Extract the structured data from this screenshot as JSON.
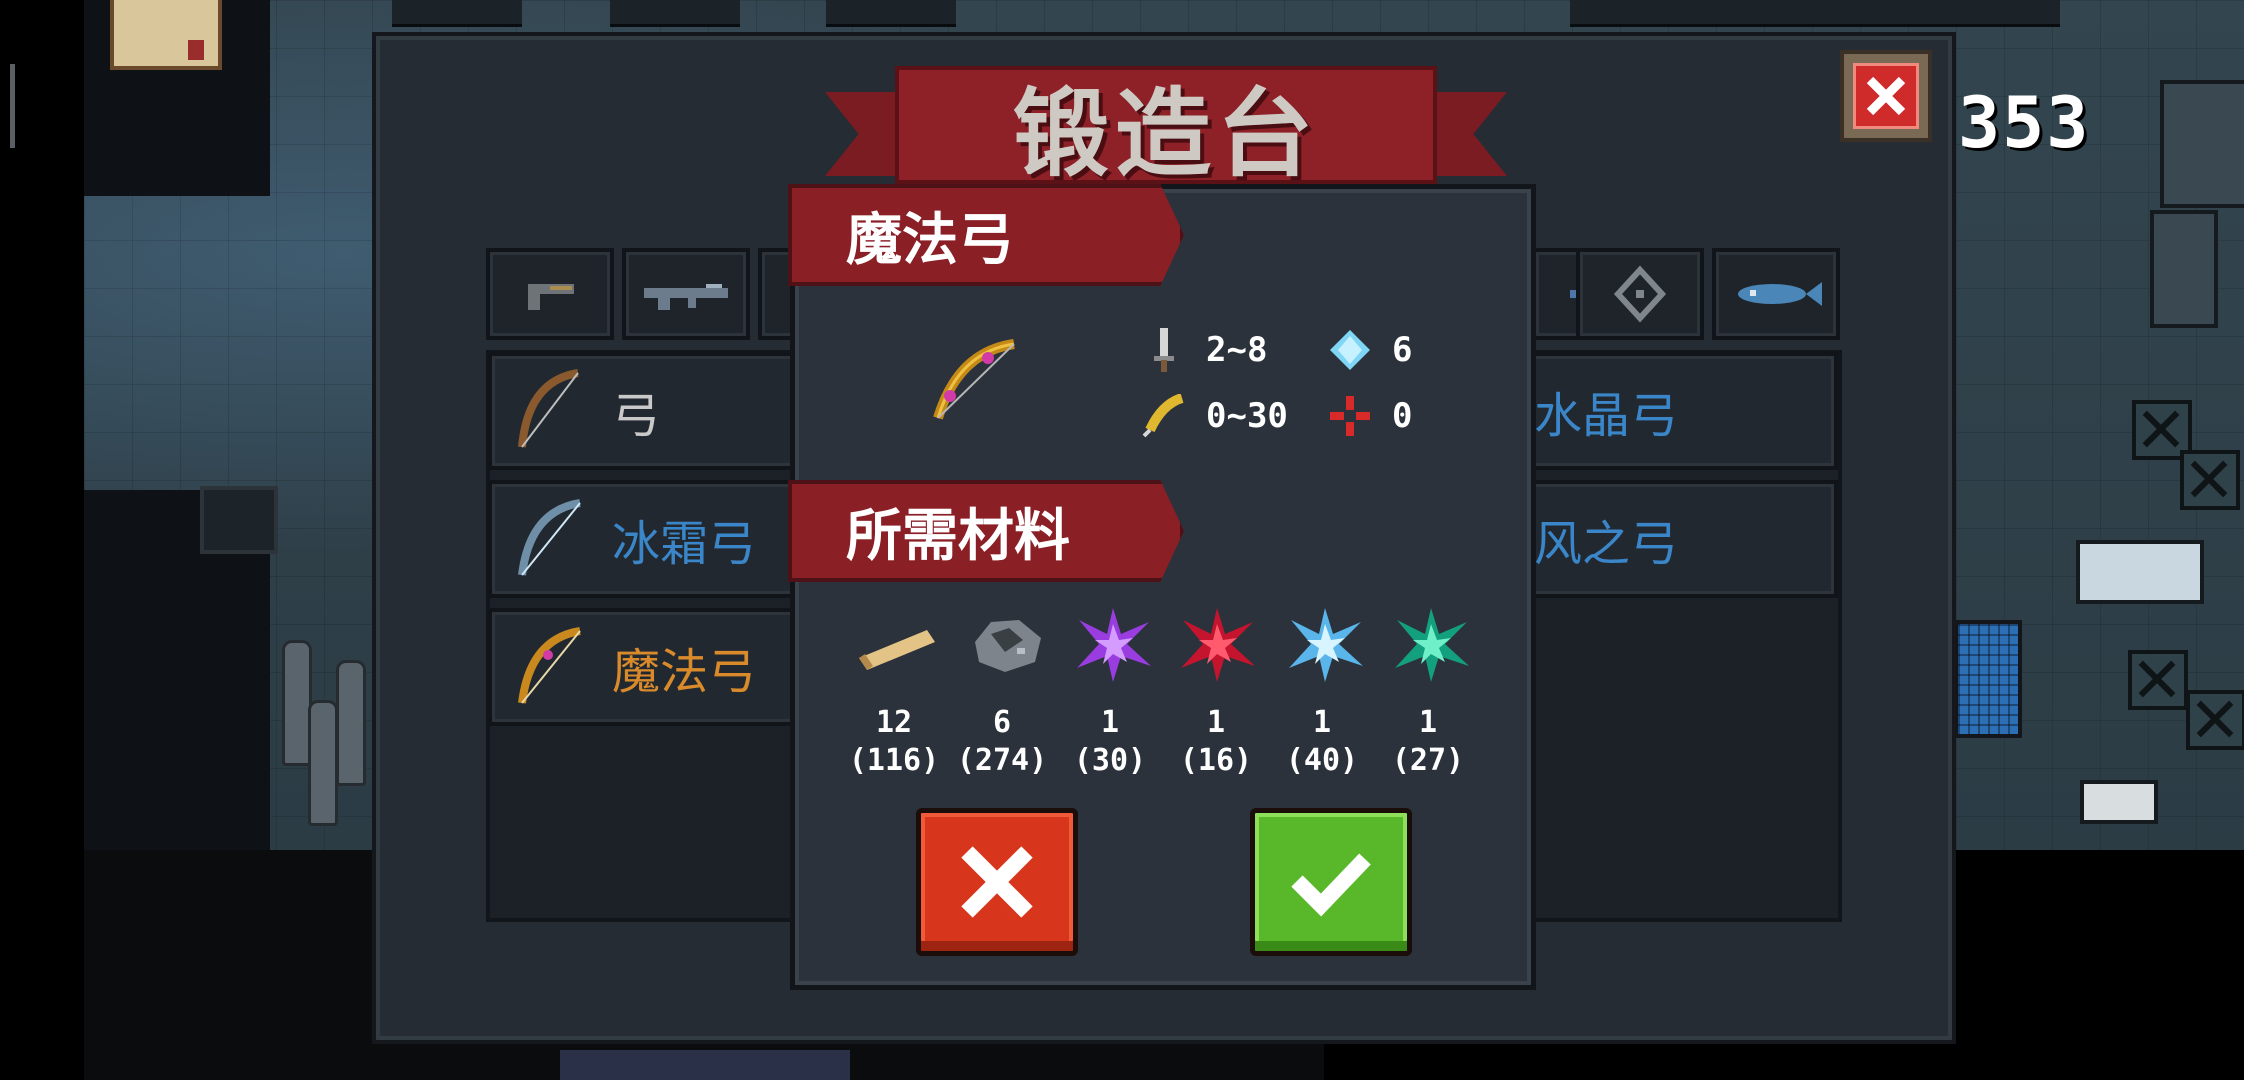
{
  "panel": {
    "title": "锻造台",
    "coins": "353"
  },
  "weapon_list": [
    {
      "label": "弓",
      "color": "#c9c9c9"
    },
    {
      "label": "冰霜弓",
      "color": "#3a86c8"
    },
    {
      "label": "魔法弓",
      "color": "#d98b2b"
    },
    {
      "label": "水晶弓",
      "color": "#3a86c8"
    },
    {
      "label": "风之弓",
      "color": "#3a86c8"
    }
  ],
  "detail": {
    "weapon_name": "魔法弓",
    "stats": {
      "damage": "2~8",
      "energy": "6",
      "accuracy": "0~30",
      "critical": "0"
    },
    "materials_title": "所需材料",
    "materials": [
      {
        "icon": "wood-log-icon",
        "required": "12",
        "owned": "(116)"
      },
      {
        "icon": "iron-ore-icon",
        "required": "6",
        "owned": "(274)"
      },
      {
        "icon": "purple-crystal-icon",
        "required": "1",
        "owned": "(30)"
      },
      {
        "icon": "red-crystal-icon",
        "required": "1",
        "owned": "(16)"
      },
      {
        "icon": "ice-crystal-icon",
        "required": "1",
        "owned": "(40)"
      },
      {
        "icon": "green-crystal-icon",
        "required": "1",
        "owned": "(27)"
      }
    ]
  },
  "colors": {
    "banner_red": "#8b1f26",
    "cancel_red": "#d8361c",
    "confirm_green": "#58b82a"
  }
}
